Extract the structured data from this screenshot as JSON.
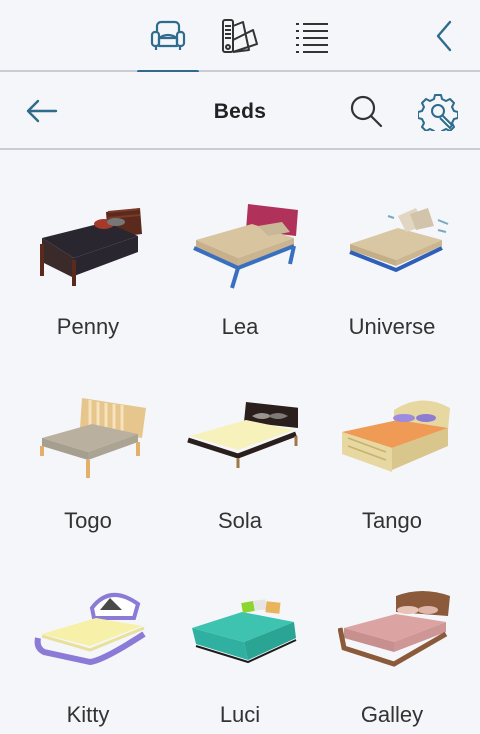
{
  "toolbar": {
    "tabs": [
      {
        "name": "furniture",
        "icon": "armchair-icon",
        "active": true
      },
      {
        "name": "materials",
        "icon": "swatch-fan-icon",
        "active": false
      },
      {
        "name": "list",
        "icon": "list-icon",
        "active": false
      }
    ],
    "accent": "#2e6b8c"
  },
  "header": {
    "title": "Beds",
    "back_icon": "arrow-left-icon",
    "search_icon": "search-icon",
    "settings_icon": "gear-wrench-icon"
  },
  "beds": [
    {
      "label": "Penny",
      "frame": "#5a2a1c",
      "cover": "#2a2630",
      "pillow": "#a33a2a"
    },
    {
      "label": "Lea",
      "frame": "#3a6fc0",
      "cover": "#d8c5a0",
      "pillow": "#b0325a"
    },
    {
      "label": "Universe",
      "frame": "#2f5fb8",
      "cover": "#d9c6a2",
      "pillow": "#e0d6c2"
    },
    {
      "label": "Togo",
      "frame": "#e3b06a",
      "cover": "#b9b0a0",
      "pillow": "#e7c68d"
    },
    {
      "label": "Sola",
      "frame": "#2a1f1c",
      "cover": "#f7f2bb",
      "pillow": "#9a958e"
    },
    {
      "label": "Tango",
      "frame": "#e7d7a1",
      "cover": "#ef9a55",
      "pillow": "#9b8ce0"
    },
    {
      "label": "Kitty",
      "frame": "#8b7ad6",
      "cover": "#f7f0a8",
      "pillow": "#4a4a4a"
    },
    {
      "label": "Luci",
      "frame": "#2fb0a0",
      "cover": "#3ec3b0",
      "pillow": "#8cd42f"
    },
    {
      "label": "Galley",
      "frame": "#8a5a3a",
      "cover": "#dca3a3",
      "pillow": "#e8c4b8"
    }
  ]
}
